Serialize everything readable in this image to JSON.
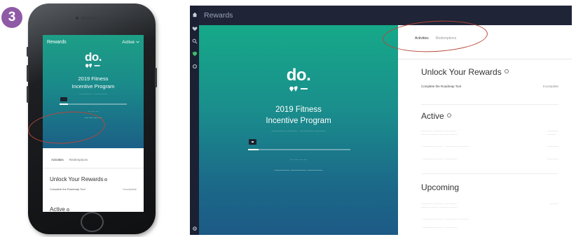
{
  "step": {
    "number": "3",
    "color": "#8e5aa6"
  },
  "phone": {
    "header": {
      "title": "Rewards",
      "filter": "Active"
    },
    "logo": "do.",
    "program_title_line1": "2019 Fitness",
    "program_title_line2": "Incentive Program",
    "progress": 0.12,
    "tabs": [
      "Activities",
      "Redemptions"
    ],
    "unlock": {
      "heading": "Unlock Your Rewards",
      "item": "Complete the Roadmap Tool",
      "status": "Incomplete"
    },
    "active_heading": "Active"
  },
  "desktop": {
    "title": "Rewards",
    "hero": {
      "logo": "do.",
      "program_title_line1": "2019 Fitness",
      "program_title_line2": "Incentive Program",
      "progress": 0.1
    },
    "tabs": [
      "Activities",
      "Redemptions"
    ],
    "unlock": {
      "heading": "Unlock Your Rewards",
      "item": "Complete the Roadmap Tool",
      "status": "Incomplete"
    },
    "active_heading": "Active",
    "upcoming_heading": "Upcoming"
  },
  "colors": {
    "accent_ring": "#b8463a",
    "hero_top": "#16a989",
    "hero_bottom": "#1c5a86",
    "titlebar": "#1f2437",
    "rail_shield": "#3fbf6a"
  },
  "icons": [
    "home-icon",
    "heart-icon",
    "search-icon",
    "shield-icon",
    "gear-icon",
    "info-icon",
    "chevron-down-icon"
  ]
}
